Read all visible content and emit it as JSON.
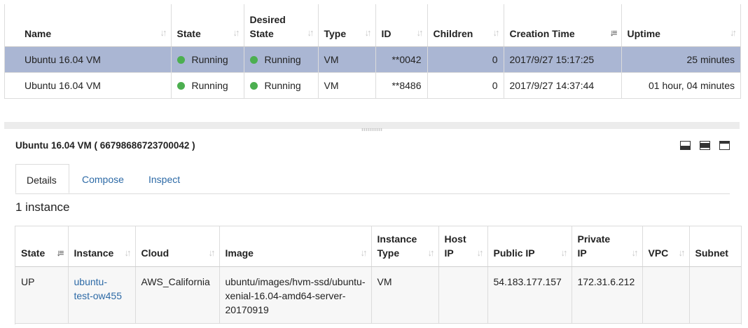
{
  "vm_table": {
    "columns": [
      {
        "label_line1": "",
        "label_line2": "Name"
      },
      {
        "label_line1": "",
        "label_line2": "State"
      },
      {
        "label_line1": "Desired",
        "label_line2": "State"
      },
      {
        "label_line1": "",
        "label_line2": "Type"
      },
      {
        "label_line1": "",
        "label_line2": "ID"
      },
      {
        "label_line1": "",
        "label_line2": "Children"
      },
      {
        "label_line1": "",
        "label_line2": "Creation Time"
      },
      {
        "label_line1": "",
        "label_line2": "Uptime"
      }
    ],
    "sort_icon": "sort-unsorted-icon",
    "sort_active_icon": "sort-desc-icon",
    "rows": [
      {
        "name": "Ubuntu 16.04 VM",
        "state": "Running",
        "desired_state": "Running",
        "type": "VM",
        "id": "**0042",
        "children": "0",
        "creation_time": "2017/9/27 15:17:25",
        "uptime": "25 minutes",
        "selected": true
      },
      {
        "name": "Ubuntu 16.04 VM",
        "state": "Running",
        "desired_state": "Running",
        "type": "VM",
        "id": "**8486",
        "children": "0",
        "creation_time": "2017/9/27 14:37:44",
        "uptime": "01 hour, 04 minutes",
        "selected": false
      }
    ]
  },
  "detail": {
    "title": "Ubuntu 16.04 VM ( 66798686723700042 )",
    "window_icons": [
      "minimize-panel-icon",
      "half-panel-icon",
      "maximize-panel-icon"
    ],
    "tabs": [
      "Details",
      "Compose",
      "Inspect"
    ],
    "active_tab": "Details",
    "instance_count": "1 instance"
  },
  "instance_table": {
    "columns": [
      {
        "label_line1": "",
        "label_line2": "State"
      },
      {
        "label_line1": "",
        "label_line2": "Instance"
      },
      {
        "label_line1": "",
        "label_line2": "Cloud"
      },
      {
        "label_line1": "",
        "label_line2": "Image"
      },
      {
        "label_line1": "Instance",
        "label_line2": "Type"
      },
      {
        "label_line1": "Host",
        "label_line2": "IP"
      },
      {
        "label_line1": "",
        "label_line2": "Public IP"
      },
      {
        "label_line1": "Private",
        "label_line2": "IP"
      },
      {
        "label_line1": "",
        "label_line2": "VPC"
      },
      {
        "label_line1": "",
        "label_line2": "Subnet"
      }
    ],
    "rows": [
      {
        "state": "UP",
        "instance": "ubuntu-test-ow455",
        "cloud": "AWS_California",
        "image": "ubuntu/images/hvm-ssd/ubuntu-xenial-16.04-amd64-server-20170919",
        "instance_type": "VM",
        "host_ip": "",
        "public_ip": "54.183.177.157",
        "private_ip": "172.31.6.212",
        "vpc": "",
        "subnet": ""
      }
    ]
  },
  "colors": {
    "selected_row": "#aab6d3",
    "status_running": "#4caf50",
    "link": "#2d6aa6"
  }
}
